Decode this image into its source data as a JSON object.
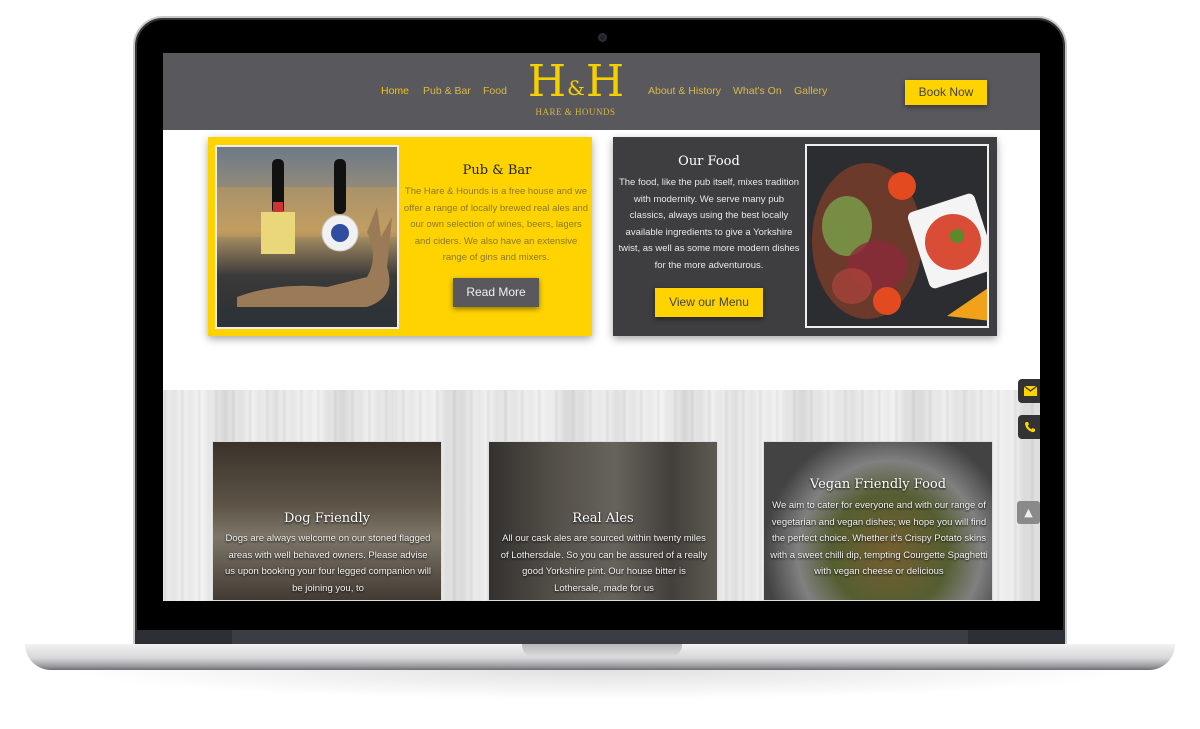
{
  "brand": {
    "logo_main_left": "H",
    "logo_amp": "&",
    "logo_main_right": "H",
    "logo_sub": "HARE & HOUNDS"
  },
  "nav": {
    "left": [
      {
        "label": "Home",
        "active": true
      },
      {
        "label": "Pub & Bar",
        "active": false
      },
      {
        "label": "Food",
        "active": false
      }
    ],
    "right": [
      {
        "label": "About & History",
        "active": false
      },
      {
        "label": "What's On",
        "active": false
      },
      {
        "label": "Gallery",
        "active": false
      }
    ],
    "book_label": "Book Now"
  },
  "cards": {
    "pub": {
      "title": "Pub & Bar",
      "text": "The Hare & Hounds is a free house and we offer a range of locally brewed real ales and our own selection of wines, beers, lagers and ciders. We also have an extensive range of gins and mixers.",
      "button": "Read More",
      "image": "bar-with-hare-statue"
    },
    "food": {
      "title": "Our Food",
      "text": "The food, like the pub itself, mixes tradition with modernity. We serve many pub classics, always using the best locally available ingredients to give a Yorkshire twist, as well as some more modern dishes for the more adventurous.",
      "button": "View our Menu",
      "image": "salad-with-dipping-sauce"
    }
  },
  "features": [
    {
      "title": "Dog Friendly",
      "text": "Dogs are always welcome on our stoned flagged areas with well behaved owners. Please advise us upon booking your four legged companion will be joining you, to",
      "image": "pub-interior-fireplace"
    },
    {
      "title": "Real Ales",
      "text": "All our cask ales are sourced within twenty miles of Lothersdale. So you can be assured of a really good Yorkshire pint. Our house bitter is Lothersale, made for us",
      "image": "beer-pumps"
    },
    {
      "title": "Vegan Friendly Food",
      "text": "We aim to cater for everyone and with our range of vegetarian and vegan dishes; we hope you will find the perfect choice. Whether it's Crispy Potato skins with a sweet chilli dip, tempting Courgette Spaghetti with vegan cheese or delicious",
      "image": "vegan-dish"
    }
  ],
  "side_buttons": {
    "email_icon": "envelope-icon",
    "phone_icon": "phone-icon",
    "top_icon": "chevron-up-icon"
  },
  "colors": {
    "header_bg": "#59585d",
    "accent_yellow": "#ffd300",
    "dark_card": "#3e3e40",
    "nav_text": "#d9b94a"
  }
}
